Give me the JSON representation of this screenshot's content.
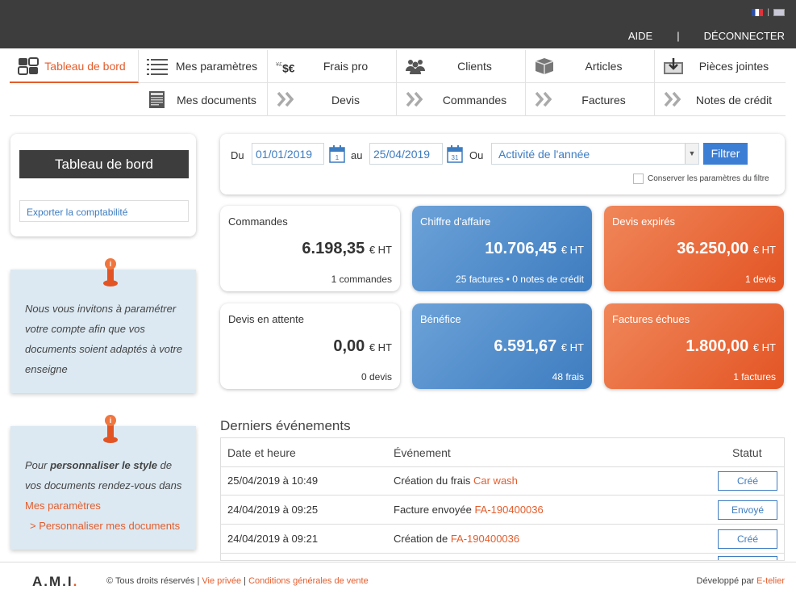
{
  "header": {
    "help": "AIDE",
    "separator": "|",
    "logout": "DÉCONNECTER",
    "lang_separator": "|"
  },
  "nav": {
    "row1": [
      {
        "label": "Tableau de bord",
        "icon": "dashboard-icon"
      },
      {
        "label": "Mes paramètres",
        "icon": "list-icon"
      },
      {
        "label": "Frais pro",
        "icon": "currency-icon"
      },
      {
        "label": "Clients",
        "icon": "users-icon"
      },
      {
        "label": "Articles",
        "icon": "box-icon"
      },
      {
        "label": "Pièces jointes",
        "icon": "download-tray-icon"
      }
    ],
    "row2": [
      {
        "label": "Mes documents",
        "icon": "document-icon"
      },
      {
        "label": "Devis",
        "icon": "double-chevron-icon"
      },
      {
        "label": "Commandes",
        "icon": "double-chevron-icon"
      },
      {
        "label": "Factures",
        "icon": "double-chevron-icon"
      },
      {
        "label": "Notes de crédit",
        "icon": "double-chevron-icon"
      }
    ]
  },
  "sidebar": {
    "title": "Tableau de bord",
    "export": "Exporter la comptabilité",
    "note1": "Nous vous invitons à paramétrer votre compte afin que vos documents soient adaptés à votre enseigne",
    "note2_prefix": "Pour ",
    "note2_bold": "personnaliser le style",
    "note2_suffix": " de vos documents rendez-vous dans",
    "note2_link1": "Mes paramètres",
    "note2_link2": "> Personnaliser mes documents"
  },
  "filter": {
    "du": "Du",
    "date_from": "01/01/2019",
    "cal1_day": "1",
    "au": "au",
    "date_to": "25/04/2019",
    "cal2_day": "31",
    "ou": "Ou",
    "select_value": "Activité de l'année",
    "button": "Filtrer",
    "keep": "Conserver les paramètres du filtre"
  },
  "tiles": [
    {
      "title": "Commandes",
      "value": "6.198,35",
      "unit": "€ HT",
      "sub": "1 commandes",
      "style": "white"
    },
    {
      "title": "Chiffre d'affaire",
      "value": "10.706,45",
      "unit": "€ HT",
      "sub": "25 factures • 0 notes de crédit",
      "style": "blue"
    },
    {
      "title": "Devis expirés",
      "value": "36.250,00",
      "unit": "€ HT",
      "sub": "1 devis",
      "style": "orange"
    },
    {
      "title": "Devis en attente",
      "value": "0,00",
      "unit": "€ HT",
      "sub": "0 devis",
      "style": "white"
    },
    {
      "title": "Bénéfice",
      "value": "6.591,67",
      "unit": "€ HT",
      "sub": "48 frais",
      "style": "blue"
    },
    {
      "title": "Factures échues",
      "value": "1.800,00",
      "unit": "€ HT",
      "sub": "1 factures",
      "style": "orange"
    }
  ],
  "events": {
    "title": "Derniers événements",
    "headers": [
      "Date et heure",
      "Événement",
      "Statut"
    ],
    "rows": [
      {
        "date": "25/04/2019 à 10:49",
        "event_prefix": "Création du frais ",
        "event_link": "Car wash",
        "status": "Créé"
      },
      {
        "date": "24/04/2019 à 09:25",
        "event_prefix": "Facture envoyée ",
        "event_link": "FA-190400036",
        "status": "Envoyé"
      },
      {
        "date": "24/04/2019 à 09:21",
        "event_prefix": "Création de ",
        "event_link": "FA-190400036",
        "status": "Créé"
      }
    ]
  },
  "footer": {
    "logo_text": "A.M.I",
    "logo_dot": ".",
    "copyright": "© Tous droits réservés",
    "sep": " | ",
    "privacy": "Vie privée",
    "terms": "Conditions générales de vente",
    "dev_prefix": "Développé par ",
    "dev_link": "E-telier"
  },
  "colors": {
    "accent": "#e35d2c",
    "blue": "#3d7cc0",
    "topbar": "#3d3d3d",
    "note_bg": "#dce9f2"
  }
}
